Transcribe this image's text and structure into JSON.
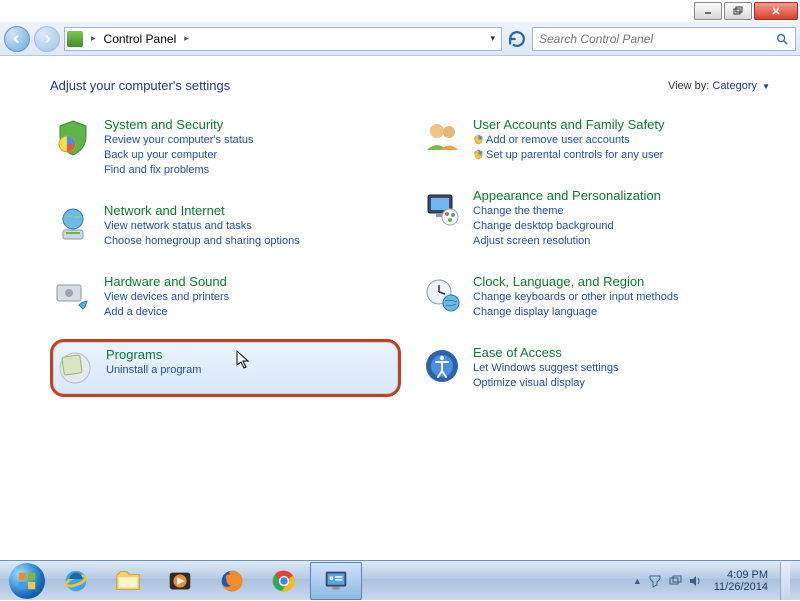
{
  "window": {
    "title": "Control Panel"
  },
  "address": {
    "location": "Control Panel"
  },
  "search": {
    "placeholder": "Search Control Panel"
  },
  "heading": "Adjust your computer's settings",
  "viewby": {
    "label": "View by:",
    "value": "Category"
  },
  "left": [
    {
      "title": "System and Security",
      "links": [
        "Review your computer's status",
        "Back up your computer",
        "Find and fix problems"
      ]
    },
    {
      "title": "Network and Internet",
      "links": [
        "View network status and tasks",
        "Choose homegroup and sharing options"
      ]
    },
    {
      "title": "Hardware and Sound",
      "links": [
        "View devices and printers",
        "Add a device"
      ]
    },
    {
      "title": "Programs",
      "links": [
        "Uninstall a program"
      ],
      "hovered": true
    }
  ],
  "right": [
    {
      "title": "User Accounts and Family Safety",
      "links": [
        "Add or remove user accounts",
        "Set up parental controls for any user"
      ],
      "shield": true
    },
    {
      "title": "Appearance and Personalization",
      "links": [
        "Change the theme",
        "Change desktop background",
        "Adjust screen resolution"
      ]
    },
    {
      "title": "Clock, Language, and Region",
      "links": [
        "Change keyboards or other input methods",
        "Change display language"
      ]
    },
    {
      "title": "Ease of Access",
      "links": [
        "Let Windows suggest settings",
        "Optimize visual display"
      ]
    }
  ],
  "taskbar": {
    "items": [
      "internet-explorer",
      "file-explorer",
      "media-player",
      "firefox",
      "chrome",
      "control-panel"
    ]
  },
  "tray": {
    "time": "4:09 PM",
    "date": "11/26/2014"
  }
}
